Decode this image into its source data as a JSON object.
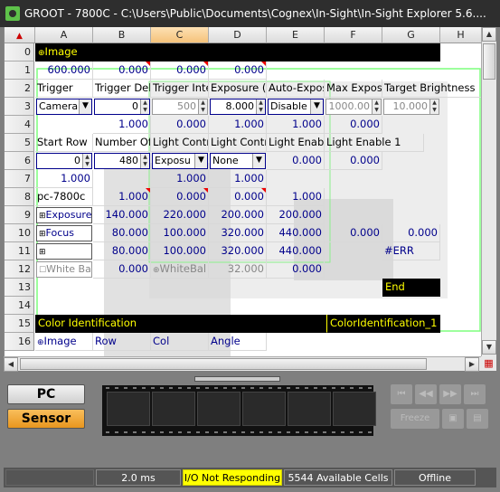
{
  "window": {
    "title": "GROOT - 7800C - C:\\Users\\Public\\Documents\\Cognex\\In-Sight\\In-Sight Explorer 5.6...."
  },
  "columns": [
    "A",
    "B",
    "C",
    "D",
    "E",
    "F",
    "G",
    "H"
  ],
  "rows": [
    "0",
    "1",
    "2",
    "3",
    "4",
    "5",
    "6",
    "7",
    "8",
    "9",
    "10",
    "11",
    "12",
    "13",
    "14",
    "15",
    "16"
  ],
  "cells": {
    "a0": "Image",
    "a1": "600.000",
    "b1": "0.000",
    "c1": "0.000",
    "d1": "0.000",
    "a2": "Trigger",
    "b2": "Trigger Del",
    "c2": "Trigger Inte",
    "d2": "Exposure (i",
    "e2": "Auto-Expos",
    "f2": "Max Exposu",
    "g2": "Target Brightness",
    "a3": "Camera",
    "b3": "0",
    "c3": "500",
    "d3": "8.000",
    "e3": "Disable",
    "f3": "1000.00",
    "g3": "10.000",
    "b4": "1.000",
    "c4": "0.000",
    "d4": "1.000",
    "e4": "1.000",
    "f4": "0.000",
    "a5": "Start Row",
    "b5": "Number Of",
    "c5": "Light Contr",
    "d5": "Light Contr",
    "e5": "Light Enabl",
    "f5": "Light Enable 1",
    "a6": "0",
    "b6": "480",
    "c6": "Exposu",
    "d6": "None",
    "e6": "0.000",
    "f6": "0.000",
    "a7": "1.000",
    "c7": "1.000",
    "d7": "1.000",
    "a8": "pc-7800c",
    "b8": "1.000",
    "c8": "0.000",
    "d8": "0.000",
    "e8": "1.000",
    "a9": "Exposure",
    "b9": "140.000",
    "c9": "220.000",
    "d9": "200.000",
    "e9": "200.000",
    "a10": "Focus",
    "b10": "80.000",
    "c10": "100.000",
    "d10": "320.000",
    "e10": "440.000",
    "f10": "0.000",
    "g10": "0.000",
    "b11": "80.000",
    "c11": "100.000",
    "d11": "320.000",
    "e11": "440.000",
    "g11": "#ERR",
    "a12": "White Ba",
    "b12": "0.000",
    "c12": "WhiteBal",
    "d12": "32.000",
    "e12": "0.000",
    "g13": "End",
    "a15": "Color Identification",
    "f15": "ColorIdentification_1",
    "a16": "Image",
    "b16": "Row",
    "c16": "Col",
    "d16": "Angle"
  },
  "mode": {
    "pc_label": "PC",
    "sensor_label": "Sensor"
  },
  "nav": {
    "freeze_label": "Freeze"
  },
  "status": {
    "time": "2.0 ms",
    "io": "I/O Not Responding",
    "cells": "5544 Available Cells",
    "conn": "Offline"
  },
  "colors": {
    "io_badge": "#ffff00",
    "sensor_button": "#f5a623",
    "accent_selected_column": "#f5c27a"
  }
}
